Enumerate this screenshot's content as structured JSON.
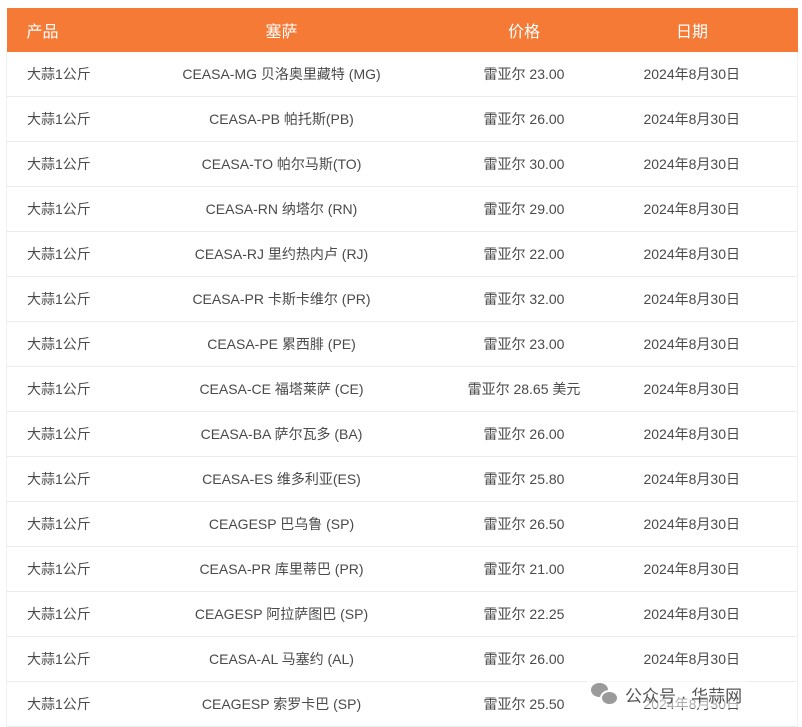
{
  "table": {
    "headers": {
      "product": "产品",
      "ceasa": "塞萨",
      "price": "价格",
      "date": "日期"
    },
    "rows": [
      {
        "product": "大蒜1公斤",
        "ceasa": "CEASA-MG 贝洛奥里藏特 (MG)",
        "price": "雷亚尔 23.00",
        "date": "2024年8月30日"
      },
      {
        "product": "大蒜1公斤",
        "ceasa": "CEASA-PB 帕托斯(PB)",
        "price": "雷亚尔 26.00",
        "date": "2024年8月30日"
      },
      {
        "product": "大蒜1公斤",
        "ceasa": "CEASA-TO 帕尔马斯(TO)",
        "price": "雷亚尔 30.00",
        "date": "2024年8月30日"
      },
      {
        "product": "大蒜1公斤",
        "ceasa": "CEASA-RN 纳塔尔 (RN)",
        "price": "雷亚尔 29.00",
        "date": "2024年8月30日"
      },
      {
        "product": "大蒜1公斤",
        "ceasa": "CEASA-RJ 里约热内卢 (RJ)",
        "price": "雷亚尔 22.00",
        "date": "2024年8月30日"
      },
      {
        "product": "大蒜1公斤",
        "ceasa": "CEASA-PR 卡斯卡维尔 (PR)",
        "price": "雷亚尔 32.00",
        "date": "2024年8月30日"
      },
      {
        "product": "大蒜1公斤",
        "ceasa": "CEASA-PE 累西腓 (PE)",
        "price": "雷亚尔 23.00",
        "date": "2024年8月30日"
      },
      {
        "product": "大蒜1公斤",
        "ceasa": "CEASA-CE 福塔莱萨 (CE)",
        "price": "雷亚尔 28.65 美元",
        "date": "2024年8月30日"
      },
      {
        "product": "大蒜1公斤",
        "ceasa": "CEASA-BA 萨尔瓦多 (BA)",
        "price": "雷亚尔 26.00",
        "date": "2024年8月30日"
      },
      {
        "product": "大蒜1公斤",
        "ceasa": "CEASA-ES 维多利亚(ES)",
        "price": "雷亚尔 25.80",
        "date": "2024年8月30日"
      },
      {
        "product": "大蒜1公斤",
        "ceasa": "CEAGESP 巴乌鲁 (SP)",
        "price": "雷亚尔 26.50",
        "date": "2024年8月30日"
      },
      {
        "product": "大蒜1公斤",
        "ceasa": "CEASA-PR 库里蒂巴 (PR)",
        "price": "雷亚尔 21.00",
        "date": "2024年8月30日"
      },
      {
        "product": "大蒜1公斤",
        "ceasa": "CEAGESP 阿拉萨图巴 (SP)",
        "price": "雷亚尔 22.25",
        "date": "2024年8月30日"
      },
      {
        "product": "大蒜1公斤",
        "ceasa": "CEASA-AL 马塞约 (AL)",
        "price": "雷亚尔 26.00",
        "date": "2024年8月30日"
      },
      {
        "product": "大蒜1公斤",
        "ceasa": "CEAGESP 索罗卡巴 (SP)",
        "price": "雷亚尔 25.50",
        "date": "2024年8月30日"
      }
    ]
  },
  "watermark": {
    "text": "公众号 · 华蒜网",
    "icon": "wechat-icon"
  },
  "colors": {
    "header_bg": "#f47a35",
    "header_text": "#ffffff",
    "cell_text": "#4a4a4a"
  }
}
